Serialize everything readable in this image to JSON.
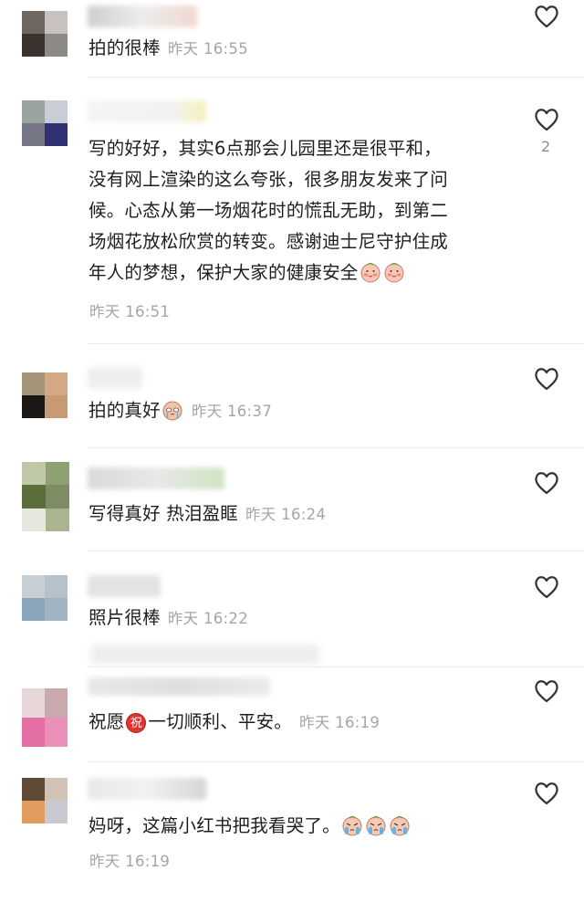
{
  "comments": [
    {
      "text": "拍的很棒",
      "time": "昨天 16:55"
    },
    {
      "text_lines": [
        "写的好好，其实6点那会儿园里还是很平和，",
        "没有网上渲染的这么夸张，很多朋友发来了问",
        "候。心态从第一场烟花时的慌乱无助，到第二",
        "场烟花放松欣赏的转变。感谢迪士尼守护住成",
        "年人的梦想，保护大家的健康安全"
      ],
      "time": "昨天 16:51",
      "likes": "2"
    },
    {
      "text": "拍的真好",
      "time": "昨天 16:37"
    },
    {
      "text": "写得真好 热泪盈眶",
      "time": "昨天 16:24"
    },
    {
      "text": "照片很棒",
      "time": "昨天 16:22"
    },
    {
      "text_before": "祝愿",
      "badge": "祝",
      "text_after": "一切顺利、平安。",
      "time": "昨天 16:19"
    },
    {
      "text": "妈呀，这篇小红书把我看哭了。",
      "time": "昨天 16:19"
    }
  ],
  "icons": {
    "like": "heart-outline-icon",
    "emoji_blush": "blush-face-emoji",
    "emoji_tears": "tearful-face-emoji",
    "emoji_cry": "crying-face-emoji"
  },
  "colors": {
    "text": "#1e1e1e",
    "meta": "#a5a5a5",
    "heart": "#333333",
    "badge": "#e0322f"
  }
}
